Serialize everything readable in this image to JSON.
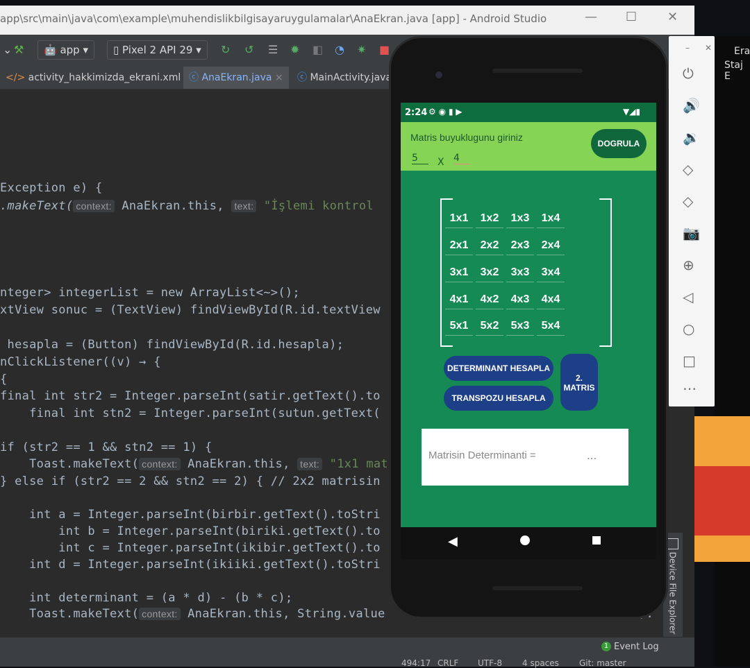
{
  "ide": {
    "title": "app\\src\\main\\java\\com\\example\\muhendislikbilgisayaruygulamalar\\AnaEkran.java [app] - Android Studio",
    "window_buttons": {
      "minimize": "—",
      "maximize": "☐",
      "close": "✕"
    },
    "toolbar": {
      "module": "app",
      "device": "Pixel 2 API 29"
    },
    "tabs": [
      {
        "label": "activity_hakkimizda_ekrani.xml",
        "close": "×"
      },
      {
        "label": "AnaEkran.java",
        "close": "×"
      },
      {
        "label": "MainActivity.java",
        "close": ""
      }
    ],
    "hints": {
      "context": "context:",
      "text": "text:"
    },
    "code": {
      "l1": "Exception e) {",
      "l2a": ".makeText(",
      "l2b": " AnaEkran.this, ",
      "l2c": " \"İşlemi kontrol",
      "l3": "nteger> integerList = new ArrayList<~>();",
      "l4": "xtView sonuc = (TextView) findViewById(R.id.textView",
      "l5": " hesapla = (Button) findViewById(R.id.hesapla);",
      "l6": "nClickListener((v) → {",
      "l7": "{",
      "l8": "final int str2 = Integer.parseInt(satir.getText().to",
      "l9": "    final int stn2 = Integer.parseInt(sutun.getText(",
      "l10": "if (str2 == 1 && stn2 == 1) {",
      "l11a": "    Toast.makeText(",
      "l11b": " AnaEkran.this, ",
      "l11c": " \"1x1 mat",
      "l12": "} else if (str2 == 2 && stn2 == 2) { // 2x2 matrisin",
      "l13": "    int a = Integer.parseInt(birbir.getText().toStri",
      "l14": "        int b = Integer.parseInt(biriki.getText().to",
      "l15": "        int c = Integer.parseInt(ikibir.getText().to",
      "l16": "    int d = Integer.parseInt(ikiiki.getText().toStri",
      "l17": "    int determinant = (a * d) - (b * c);",
      "l18a": "    Toast.makeText(",
      "l18b": " AnaEkran.this, String.value",
      "l18c": ")."
    },
    "status": {
      "event_log": "Event Log",
      "event_count": "1",
      "position": "494:17",
      "line_sep": "CRLF",
      "encoding": "UTF-8",
      "indent": "4 spaces",
      "vcs": "Git: master"
    },
    "side_panel": "Device File Explorer"
  },
  "right_window": {
    "text1": "Era",
    "text2": "Staj E"
  },
  "phone": {
    "time": "2:24",
    "prompt": "Matris buyuklugunu giriniz",
    "rows_value": "5",
    "times_sign": "X",
    "cols_value": "4",
    "verify_button": "DOGRULA",
    "matrix": [
      [
        "1x1",
        "1x2",
        "1x3",
        "1x4"
      ],
      [
        "2x1",
        "2x2",
        "2x3",
        "2x4"
      ],
      [
        "3x1",
        "3x2",
        "3x3",
        "3x4"
      ],
      [
        "4x1",
        "4x2",
        "4x3",
        "4x4"
      ],
      [
        "5x1",
        "5x2",
        "5x3",
        "5x4"
      ]
    ],
    "determinant_button": "DETERMINANT HESAPLA",
    "transpose_button": "TRANSPOZU HESAPLA",
    "second_matrix_button": "2. MATRIS",
    "result_label": "Matrisin Determinanti =",
    "result_value": "..."
  }
}
